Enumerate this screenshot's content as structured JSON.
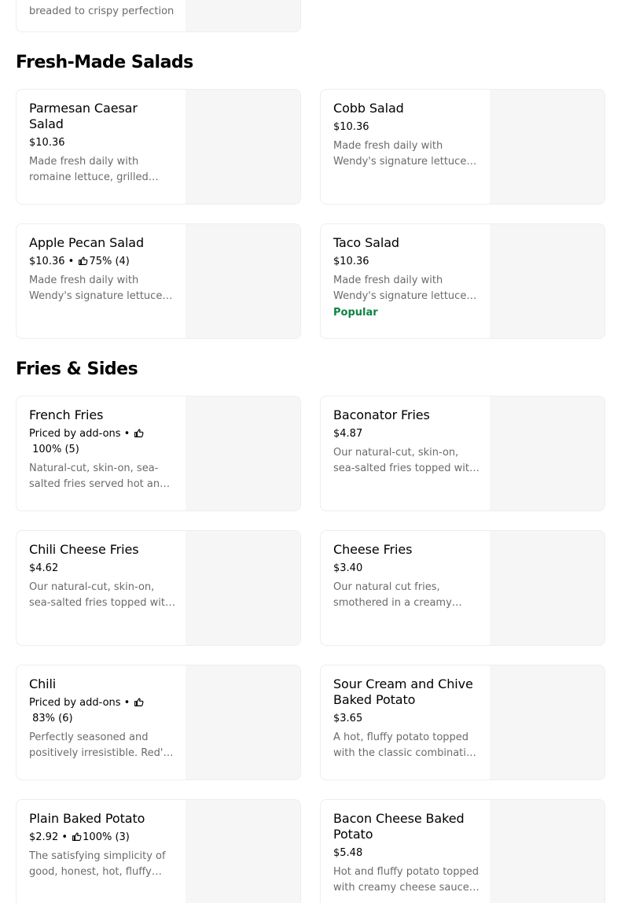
{
  "top_card": {
    "desc": "breaded to crispy perfection"
  },
  "sections": [
    {
      "title": "Fresh-Made Salads",
      "items": [
        {
          "name": "Parmesan Caesar Salad",
          "price": "$10.36",
          "rating": "",
          "desc": "Made fresh daily with romaine lettuce, grilled chicken, parmesan cheese and croutons",
          "badge": ""
        },
        {
          "name": "Cobb Salad",
          "price": "$10.36",
          "rating": "",
          "desc": "Made fresh daily with Wendy's signature lettuce blend",
          "badge": ""
        },
        {
          "name": "Apple Pecan Salad",
          "price": "$10.36",
          "rating": "75% (4)",
          "desc": "Made fresh daily with Wendy's signature lettuce blend",
          "badge": ""
        },
        {
          "name": "Taco Salad",
          "price": "$10.36",
          "rating": "",
          "desc": "Made fresh daily with Wendy's signature lettuce blend",
          "badge": "Popular"
        }
      ]
    },
    {
      "title": "Fries & Sides",
      "items": [
        {
          "name": "French Fries",
          "price": "Priced by add-ons",
          "rating": "100% (5)",
          "desc": "Natural-cut, skin-on, sea-salted fries served hot and crispy",
          "badge": ""
        },
        {
          "name": "Baconator Fries",
          "price": "$4.87",
          "rating": "",
          "desc": "Our natural-cut, skin-on, sea-salted fries topped with cheese sauce and bacon",
          "badge": ""
        },
        {
          "name": "Chili Cheese Fries",
          "price": "$4.62",
          "rating": "",
          "desc": "Our natural-cut, skin-on, sea-salted fries topped with chili and cheese",
          "badge": ""
        },
        {
          "name": "Cheese Fries",
          "price": "$3.40",
          "rating": "",
          "desc": "Our natural cut fries, smothered in a creamy cheese sauce",
          "badge": ""
        },
        {
          "name": "Chili",
          "price": "Priced by add-ons",
          "rating": "83% (6)",
          "desc": "Perfectly seasoned and positively irresistible. Red's famous chili recipe",
          "badge": ""
        },
        {
          "name": "Sour Cream and Chive Baked Potato",
          "price": "$3.65",
          "rating": "",
          "desc": "A hot, fluffy potato topped with the classic combination of sour cream and chives",
          "badge": ""
        },
        {
          "name": "Plain Baked Potato",
          "price": "$2.92",
          "rating": "100% (3)",
          "desc": "The satisfying simplicity of good, honest, hot, fluffy baked potato",
          "badge": ""
        },
        {
          "name": "Bacon Cheese Baked Potato",
          "price": "$5.48",
          "rating": "",
          "desc": "Hot and fluffy potato topped with creamy cheese sauce, and bacon",
          "badge": ""
        }
      ]
    }
  ],
  "icons": {
    "rating": "thumbs-up-icon"
  },
  "colors": {
    "popular": "#0e8345",
    "image_placeholder": "#f6f6f6",
    "description": "#6b6b6b"
  }
}
